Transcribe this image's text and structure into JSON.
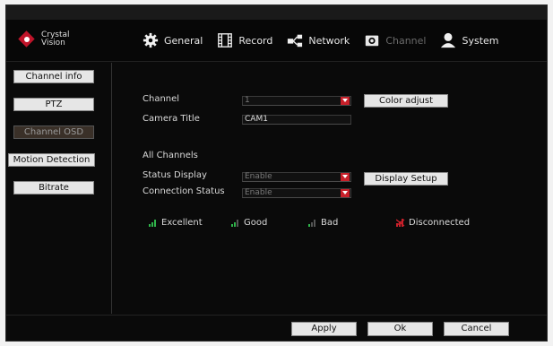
{
  "logo": {
    "line1": "Crystal",
    "line2": "Vision"
  },
  "nav": [
    {
      "label": "General",
      "icon": "gear-icon"
    },
    {
      "label": "Record",
      "icon": "film-icon"
    },
    {
      "label": "Network",
      "icon": "network-icon"
    },
    {
      "label": "Channel",
      "icon": "camera-icon"
    },
    {
      "label": "System",
      "icon": "user-icon"
    }
  ],
  "sidebar": {
    "items": [
      {
        "label": "Channel info"
      },
      {
        "label": "PTZ"
      },
      {
        "label": "Channel OSD"
      },
      {
        "label": "Motion Detection"
      },
      {
        "label": "Bitrate"
      }
    ]
  },
  "form": {
    "channel_label": "Channel",
    "channel_value": "1",
    "color_adjust": "Color adjust",
    "camera_title_label": "Camera Title",
    "camera_title_value": "CAM1",
    "all_channels_label": "All Channels",
    "status_display_label": "Status Display",
    "status_display_value": "Enable",
    "display_setup": "Display Setup",
    "connection_status_label": "Connection Status",
    "connection_status_value": "Enable"
  },
  "legend": {
    "excellent": "Excellent",
    "good": "Good",
    "bad": "Bad",
    "disconnected": "Disconnected"
  },
  "footer": {
    "apply": "Apply",
    "ok": "Ok",
    "cancel": "Cancel"
  },
  "colors": {
    "accent_red": "#c8202a",
    "signal_green": "#2fb34a",
    "background": "#0a0a0a"
  }
}
